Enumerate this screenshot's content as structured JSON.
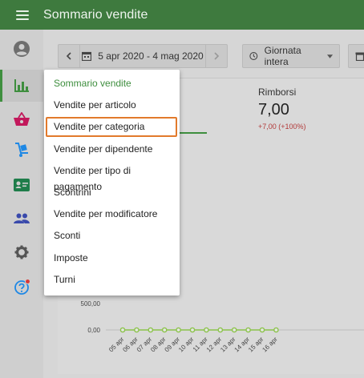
{
  "appbar": {
    "title": "Sommario vendite"
  },
  "sidebar": {
    "items": [
      {
        "icon": "account-icon"
      },
      {
        "icon": "bar-chart-icon",
        "active": true
      },
      {
        "icon": "basket-icon"
      },
      {
        "icon": "hand-truck-icon"
      },
      {
        "icon": "id-card-icon"
      },
      {
        "icon": "people-icon"
      },
      {
        "icon": "gear-icon"
      },
      {
        "icon": "help-icon",
        "badge": true
      }
    ]
  },
  "filters": {
    "date_range": "5 apr 2020 - 4 mag 2020",
    "day_part": "Giornata intera"
  },
  "refunds": {
    "label": "Rimborsi",
    "value": "7,00",
    "delta": "+7,00 (+100%)"
  },
  "menu": {
    "items": [
      "Sommario vendite",
      "Vendite per articolo",
      "Vendite per categoria",
      "Vendite per dipendente",
      "Vendite per tipo di pagamento",
      "Scontrini",
      "Vendite per modificatore",
      "Sconti",
      "Imposte",
      "Turni"
    ],
    "highlighted_index": 2
  },
  "chart_data": {
    "type": "line",
    "y_tick_labels": [
      "500,00",
      "0,00"
    ],
    "x": [
      "05 apr",
      "06 apr",
      "07 apr",
      "08 apr",
      "09 apr",
      "10 apr",
      "11 apr",
      "12 apr",
      "13 apr",
      "14 apr",
      "15 apr",
      "16 apr"
    ],
    "values": [
      0,
      0,
      0,
      0,
      0,
      0,
      0,
      0,
      0,
      0,
      0,
      0
    ],
    "color": "#8bc34a",
    "grid": true
  },
  "colors": {
    "appbar": "#3e7a3e",
    "accent": "#3e8e3e",
    "highlight": "#e27a2c",
    "negative": "#b23a3a"
  }
}
